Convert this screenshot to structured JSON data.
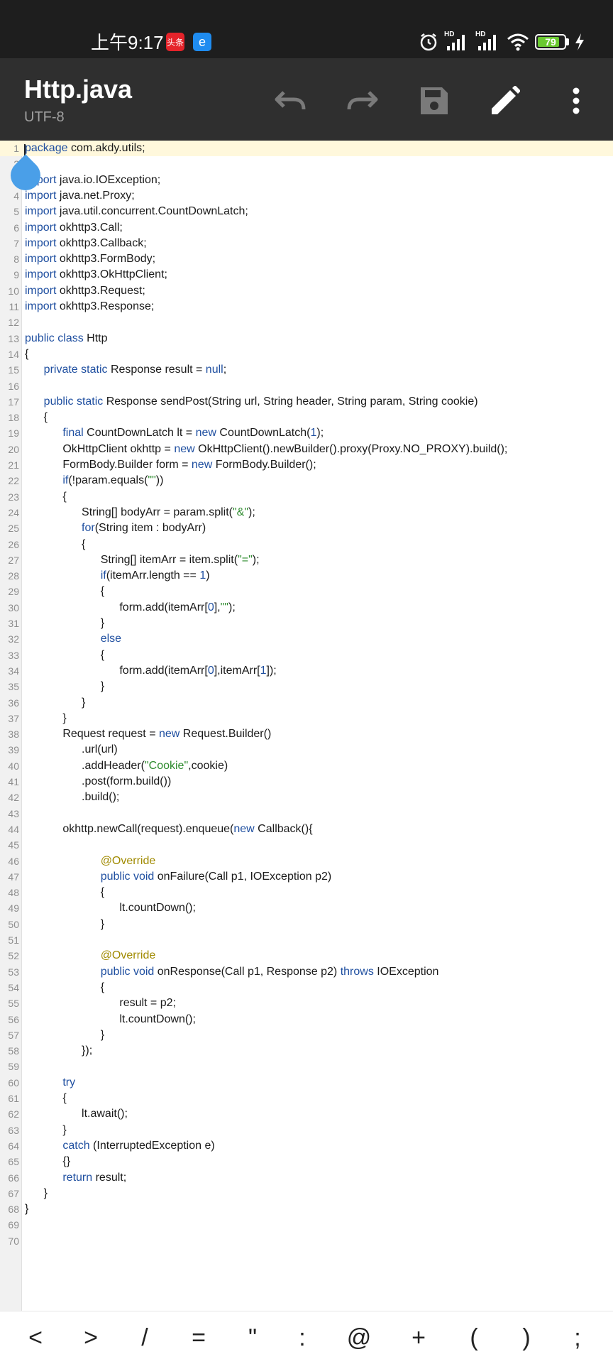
{
  "status_bar": {
    "time": "上午9:17",
    "app1_label": "头条",
    "app2_label": "e",
    "signal1": "HD",
    "signal2": "HD",
    "battery": "79"
  },
  "app_bar": {
    "title": "Http.java",
    "encoding": "UTF-8",
    "undo_icon": "undo-icon",
    "redo_icon": "redo-icon",
    "save_icon": "save-icon",
    "edit_icon": "pencil-icon",
    "menu_icon": "more-vert-icon"
  },
  "editor": {
    "current_line": 1,
    "lines": [
      "package com.akdy.utils;",
      "",
      "import java.io.IOException;",
      "import java.net.Proxy;",
      "import java.util.concurrent.CountDownLatch;",
      "import okhttp3.Call;",
      "import okhttp3.Callback;",
      "import okhttp3.FormBody;",
      "import okhttp3.OkHttpClient;",
      "import okhttp3.Request;",
      "import okhttp3.Response;",
      "",
      "public class Http",
      "{",
      "    private static Response result = null;",
      "",
      "    public static Response sendPost(String url, String header, String param, String cookie)",
      "    {",
      "        final CountDownLatch lt = new CountDownLatch(1);",
      "        OkHttpClient okhttp = new OkHttpClient().newBuilder().proxy(Proxy.NO_PROXY).build();",
      "        FormBody.Builder form = new FormBody.Builder();",
      "        if(!param.equals(\"\"))",
      "        {",
      "            String[] bodyArr = param.split(\"&\");",
      "            for(String item : bodyArr)",
      "            {",
      "                String[] itemArr = item.split(\"=\");",
      "                if(itemArr.length == 1)",
      "                {",
      "                    form.add(itemArr[0],\"\");",
      "                }",
      "                else",
      "                {",
      "                    form.add(itemArr[0],itemArr[1]);",
      "                }",
      "            }",
      "        }",
      "        Request request = new Request.Builder()",
      "            .url(url)",
      "            .addHeader(\"Cookie\",cookie)",
      "            .post(form.build())",
      "            .build();",
      "",
      "        okhttp.newCall(request).enqueue(new Callback(){",
      "",
      "                @Override",
      "                public void onFailure(Call p1, IOException p2)",
      "                {",
      "                    lt.countDown();",
      "                }",
      "",
      "                @Override",
      "                public void onResponse(Call p1, Response p2) throws IOException",
      "                {",
      "                    result = p2;",
      "                    lt.countDown();",
      "                }",
      "            });",
      "",
      "        try",
      "        {",
      "            lt.await();",
      "        }",
      "        catch (InterruptedException e)",
      "        {}",
      "        return result;",
      "    }",
      "}",
      "",
      ""
    ]
  },
  "symbol_bar": {
    "keys": [
      "<",
      ">",
      "/",
      "=",
      "\"",
      ":",
      "@",
      "+",
      "(",
      ")",
      ";"
    ]
  }
}
